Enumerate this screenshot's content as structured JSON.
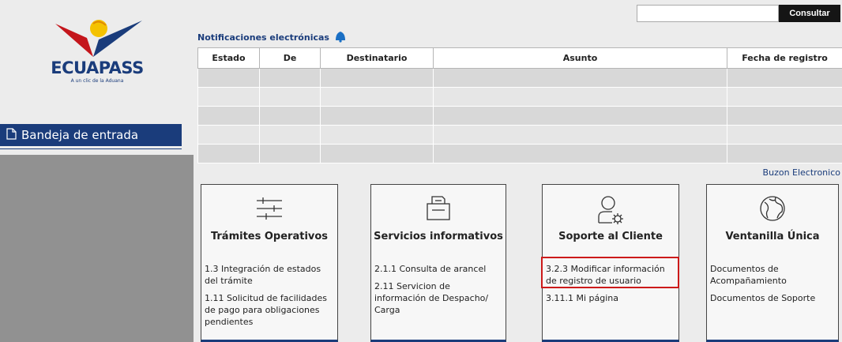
{
  "logo": {
    "word": "ECUAPASS",
    "tagline": "A un clic de la Aduana"
  },
  "sidebar": {
    "inbox_label": "Bandeja de entrada"
  },
  "search": {
    "button_label": "Consultar",
    "placeholder": ""
  },
  "notifications": {
    "title": "Notificaciones electrónicas",
    "columns": [
      "Estado",
      "De",
      "Destinatario",
      "Asunto",
      "Fecha de registro"
    ],
    "rows": [
      [],
      [],
      [],
      [],
      []
    ]
  },
  "buzon_link": "Buzon Electronico",
  "cards": [
    {
      "title": "Trámites Operativos",
      "icon": "sliders-icon",
      "links": [
        "1.3 Integración de estados del trámite",
        "1.11 Solicitud de facilidades de pago para obligaciones pendientes"
      ]
    },
    {
      "title": "Servicios informativos",
      "icon": "printer-icon",
      "links": [
        "2.1.1 Consulta de arancel",
        "2.11 Servicion de información de Despacho/ Carga"
      ]
    },
    {
      "title": "Soporte al Cliente",
      "icon": "user-gear-icon",
      "links": [
        "3.2.3 Modificar información de registro de usuario",
        "3.11.1 Mi página"
      ]
    },
    {
      "title": "Ventanilla Única",
      "icon": "globe-icon",
      "links": [
        "Documentos de Acompañamiento",
        "Documentos de Soporte"
      ]
    }
  ],
  "colors": {
    "brand": "#1a3c7b",
    "highlight": "#cc1a1a"
  }
}
